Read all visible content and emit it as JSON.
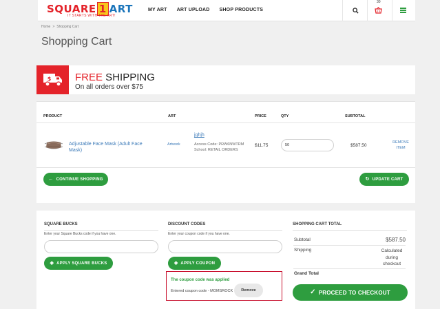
{
  "header": {
    "logo": {
      "text_square": "SQUARE",
      "text_one": "1",
      "text_art": "ART",
      "tagline": "IT STARTS WITH THE ART!"
    },
    "nav": [
      {
        "label": "MY ART"
      },
      {
        "label": "ART UPLOAD"
      },
      {
        "label": "SHOP PRODUCTS"
      }
    ],
    "cart_count": "30",
    "icons": [
      "search-icon",
      "cart-icon",
      "menu-icon"
    ]
  },
  "breadcrumb": {
    "home": "Home",
    "separator": ">",
    "current": "Shopping Cart"
  },
  "page_title": "Shopping Cart",
  "shipping_banner": {
    "free": "FREE",
    "shipping": " SHIPPING",
    "subtitle": "On all orders over $75"
  },
  "cart": {
    "columns": [
      "PRODUCT",
      "ART",
      "PRICE",
      "QTY",
      "SUBTOTAL"
    ],
    "items": [
      {
        "product": "Adjustable Face Mask (Adult Face Mask)",
        "art_image_alt": "Artwork",
        "art_name": "jghjh",
        "access_code": "Access Code: PRW6NWTRM",
        "school": "School: RETAIL ORDERS",
        "price": "$11.75",
        "qty": "50",
        "subtotal": "$587.50",
        "remove": "REMOVE ITEM"
      }
    ],
    "continue_label": "CONTINUE SHOPPING",
    "update_label": "UPDATE CART"
  },
  "square_bucks": {
    "title": "SQUARE BUCKS",
    "hint": "Enter your Square Bucks code if you have one.",
    "value": "",
    "button": "APPLY SQUARE BUCKS"
  },
  "discount": {
    "title": "DISCOUNT CODES",
    "hint": "Enter your coupon code if you have one.",
    "value": "",
    "button": "APPLY COUPON",
    "applied_message": "The coupon code was applied",
    "entered_text": "Entered coupon code - MOMSROCK",
    "remove_label": "Remove"
  },
  "totals": {
    "title": "SHOPPING CART TOTAL",
    "subtotal_label": "Subtotal",
    "subtotal_value": "$587.50",
    "shipping_label": "Shipping",
    "shipping_value": "Calculated during checkout",
    "grand_total_label": "Grand Total",
    "grand_total_value": "",
    "checkout_label": "PROCEED TO CHECKOUT"
  },
  "colors": {
    "accent_green": "#2e9d3f",
    "brand_red": "#e4232a",
    "link_blue": "#3c7ab8"
  }
}
